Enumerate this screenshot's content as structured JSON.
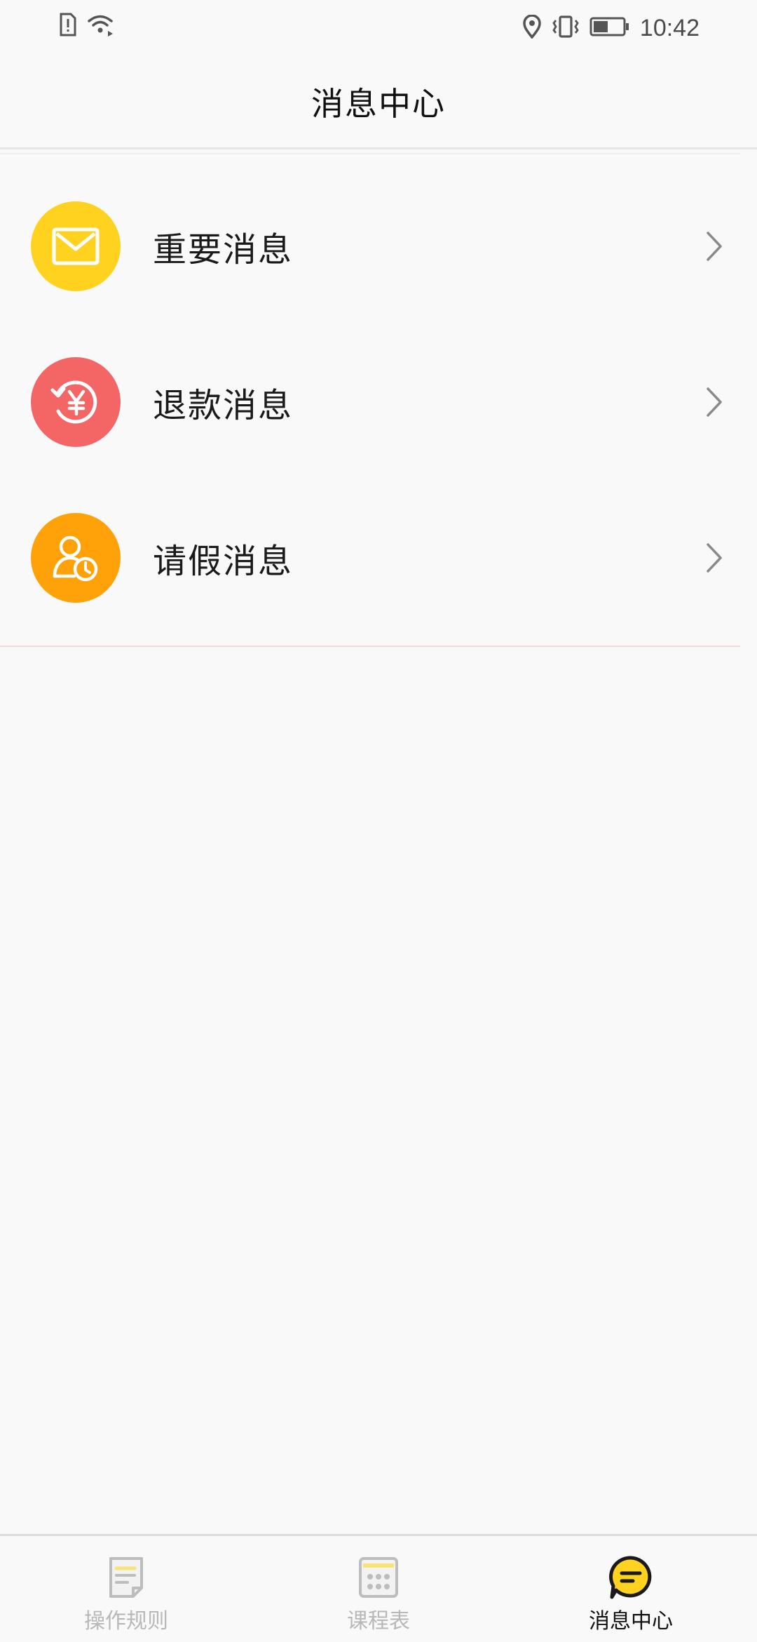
{
  "status_bar": {
    "time": "10:42",
    "icons": [
      "sim-alert-icon",
      "wifi-icon",
      "location-icon",
      "vibrate-icon",
      "battery-icon"
    ]
  },
  "header": {
    "title": "消息中心"
  },
  "messages": {
    "items": [
      {
        "label": "重要消息",
        "icon": "mail-icon",
        "color": "#FFD21F"
      },
      {
        "label": "退款消息",
        "icon": "refund-icon",
        "color": "#F46565"
      },
      {
        "label": "请假消息",
        "icon": "leave-icon",
        "color": "#FFA20A"
      }
    ]
  },
  "bottom_nav": {
    "items": [
      {
        "label": "操作规则",
        "icon": "rules-doc-icon",
        "active": false
      },
      {
        "label": "课程表",
        "icon": "calendar-icon",
        "active": false
      },
      {
        "label": "消息中心",
        "icon": "message-bubble-icon",
        "active": true
      }
    ]
  },
  "colors": {
    "background": "#F9F9F9",
    "inactive_nav": "#B8B8B8",
    "accent_yellow": "#FFD21F"
  }
}
